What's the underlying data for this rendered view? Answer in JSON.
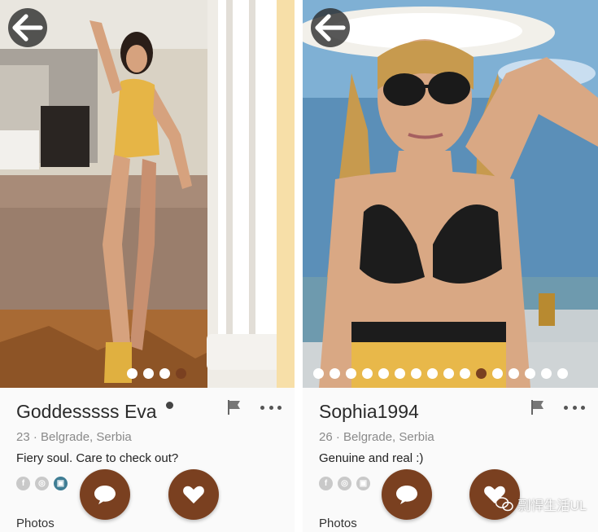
{
  "profiles": [
    {
      "name": "Goddesssss Eva",
      "age_location": "23 · Belgrade, Serbia",
      "bio": "Fiery soul. Care to check out?",
      "photo_count": 4,
      "active_photo_index": 3,
      "photos_label": "Photos",
      "socials": [
        "facebook-icon",
        "instagram-icon",
        "gallery-icon"
      ],
      "active_social_index": 2
    },
    {
      "name": "Sophia1994",
      "age_location": "26 · Belgrade, Serbia",
      "bio": "Genuine and real :)",
      "photo_count": 16,
      "active_photo_index": 10,
      "photos_label": "Photos",
      "socials": [
        "facebook-icon",
        "instagram-icon",
        "gallery-icon"
      ],
      "active_social_index": -1
    }
  ],
  "watermark": "剽悍生活UL",
  "colors": {
    "accent": "#7a4020",
    "back_button": "#2f2f2f",
    "muted_text": "#8a8a8a"
  }
}
